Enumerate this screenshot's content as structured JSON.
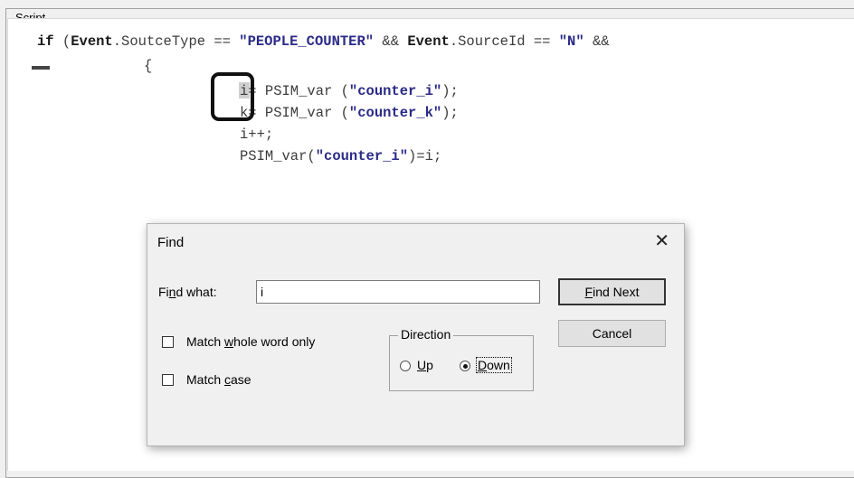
{
  "group": {
    "title": "Script"
  },
  "code": {
    "line1": {
      "kw": "if ",
      "p1": "(",
      "ev1": "Event",
      "f1": ".SoutceType == ",
      "s1": "\"PEOPLE_COUNTER\"",
      "op": " && ",
      "ev2": "Event",
      "f2": ".SourceId == ",
      "s2": "\"N\"",
      "tail": " &&"
    },
    "line2": "{",
    "line3": {
      "a": "i= PSIM_var (",
      "s": "\"counter_i\"",
      "b": ");"
    },
    "line4": {
      "a": "k= PSIM_var (",
      "s": "\"counter_k\"",
      "b": ");"
    },
    "line5": "i++;",
    "line6": {
      "a": "PSIM_var(",
      "s": "\"counter_i\"",
      "b": ")=i;"
    }
  },
  "find_dialog": {
    "title": "Find",
    "close_glyph": "✕",
    "find_what_label": {
      "pre": "Fi",
      "u": "n",
      "post": "d what:"
    },
    "find_what_value": "i",
    "find_next_button": {
      "pre": "",
      "u": "F",
      "post": "ind Next"
    },
    "cancel_button": "Cancel",
    "match_whole_word": {
      "pre": "Match ",
      "u": "w",
      "post": "hole word only",
      "checked": false
    },
    "match_case": {
      "pre": "Match ",
      "u": "c",
      "post": "ase",
      "checked": false
    },
    "direction": {
      "label": "Direction",
      "up": {
        "pre": "",
        "u": "U",
        "post": "p",
        "selected": false
      },
      "down": {
        "pre": "",
        "u": "D",
        "post": "own",
        "selected": true
      }
    }
  }
}
